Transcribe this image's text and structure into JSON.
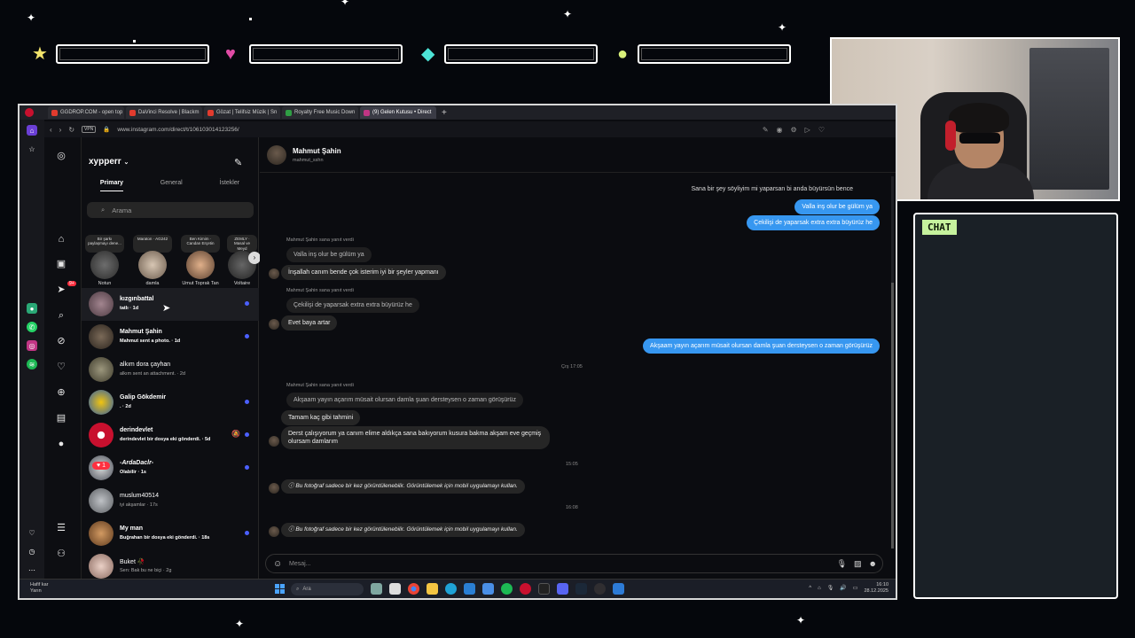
{
  "overlay": {
    "stats": [
      {
        "icon": "star-icon",
        "glyph": "★",
        "color": "#f2e36b"
      },
      {
        "icon": "heart-icon",
        "glyph": "♥",
        "color": "#e04ba5"
      },
      {
        "icon": "diamond-icon",
        "glyph": "◆",
        "color": "#4de3d6"
      },
      {
        "icon": "coin-icon",
        "glyph": "●",
        "color": "#d9f07a"
      }
    ],
    "chat_label": "CHAT"
  },
  "browser": {
    "tabs": [
      {
        "label": "GGDROP.COM - open top",
        "color": "#e23b2e"
      },
      {
        "label": "DaVinci Resolve | Blackm",
        "color": "#e23b2e"
      },
      {
        "label": "Gözat | Telifsiz Müzik | Sn",
        "color": "#e23b2e"
      },
      {
        "label": "Royalty Free Music Down",
        "color": "#2f9e44"
      },
      {
        "label": "(9) Gelen Kutusu • Direct",
        "color": "#c13584"
      }
    ],
    "vpn": "VPN",
    "url": "www.instagram.com/direct/t/106103014123256/"
  },
  "instagram": {
    "username": "xypperr",
    "tabs": [
      "Primary",
      "General",
      "İstekler"
    ],
    "search_placeholder": "Arama",
    "notification_count": "9+",
    "heart_notification": "1",
    "notes": [
      {
        "bubble": "Bir şarkı paylaşmayı dene...",
        "name": "Notun"
      },
      {
        "bubble": "Maraton · AG242",
        "name": "damla"
      },
      {
        "bubble": "Ben Kimim · Candan Erçetin",
        "name": "Umut Toprak Tan"
      },
      {
        "bubble": "ZEMLY · Masal ve Meyd",
        "name": "Voltaire"
      }
    ],
    "threads": [
      {
        "name": "kızgınbattal",
        "preview": "tatlı · 1d",
        "unread": true,
        "color": "#6b5560"
      },
      {
        "name": "Mahmut Şahin",
        "preview": "Mahmut sent a photo. · 1d",
        "unread": true,
        "color": "#4b3f35"
      },
      {
        "name": "alkım dora çayhan",
        "preview": "alkım sent an attachment. · 2d",
        "unread": false,
        "color": "#6f6a55"
      },
      {
        "name": "Galip Gökdemir",
        "preview": ". · 2d",
        "unread": true,
        "color": "#2f5ea8"
      },
      {
        "name": "derindevlet",
        "preview": "derindevlet bir dosya eki gönderdi. · 5d",
        "unread": true,
        "color": "#c8102e"
      },
      {
        "name": "-ArdaDaclr-",
        "preview": "Olabilir · 1s",
        "unread": true,
        "color": "#4a4f59"
      },
      {
        "name": "muslum40514",
        "preview": "iyi akşamlar · 17s",
        "unread": false,
        "color": "#8a8d91"
      },
      {
        "name": "My man",
        "preview": "Buğrahan bir dosya eki gönderdi. · 18s",
        "unread": true,
        "color": "#a0693e"
      },
      {
        "name": "Buket 🥀",
        "preview": "Sen: Bak bu ne biçi · 2g",
        "unread": false,
        "color": "#c9a9a0"
      }
    ],
    "chat": {
      "name": "Mahmut Şahin",
      "handle": "mahmut_sshn",
      "messages_out_top": [
        "Sana bir şey söyliyim mi yaparsan bi anda büyürsün bence",
        "Valla inş olur be gülüm ya",
        "Çekilişi de yaparsak extra extra büyürüz he"
      ],
      "reply_label": "Mahmut Şahin sana yanıt verdi",
      "quoted_1": "Valla inş olur be gülüm ya",
      "msg_1": "İnşallah canım bende çok isterim iyi bir şeyler yapmanı",
      "quoted_2": "Çekilişi de yaparsak extra extra büyürüz he",
      "msg_2": "Evet baya artar",
      "msg_out_2": "Akşaam yayın açarım müsait olursan damla şuan dersteysen o zaman görüşürüz",
      "ts_1": "Çrş 17:05",
      "quoted_3": "Akşaam yayın açarım müsait olursan damla şuan dersteysen o zaman görüşürüz",
      "msg_3": "Tamam kaç gibi tahmini",
      "msg_4": "Derst çalışıyorum ya canım elime aldıkça sana bakıyorum kusura bakma akşam eve geçmiş olursam damlarım",
      "ts_2": "15:05",
      "photo_msg": "Bu fotoğraf sadece bir kez görüntülenebilir. Görüntülemek için mobil uygulamayı kullan.",
      "ts_3": "16:08",
      "composer_placeholder": "Mesaj..."
    }
  },
  "taskbar": {
    "weather_title": "Hafif kar",
    "weather_sub": "Yarın",
    "search": "Ara",
    "time": "16:10",
    "date": "28.12.2025"
  }
}
